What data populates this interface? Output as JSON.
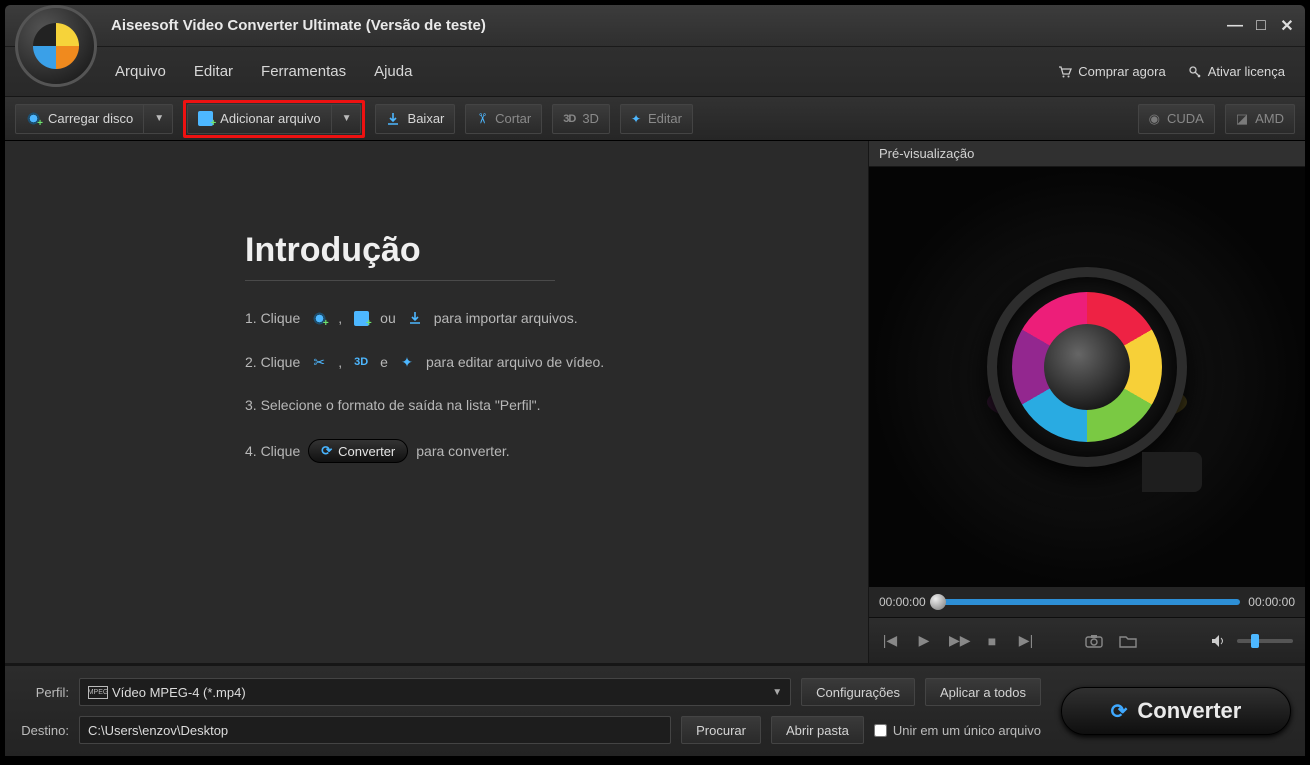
{
  "title": "Aiseesoft Video Converter Ultimate (Versão de teste)",
  "window_controls": {
    "minimize": "—",
    "maximize": "□",
    "close": "✕"
  },
  "menu": {
    "file": "Arquivo",
    "edit": "Editar",
    "tools": "Ferramentas",
    "help": "Ajuda"
  },
  "header_right": {
    "buy": "Comprar agora",
    "activate": "Ativar licença"
  },
  "toolbar": {
    "load_disc": "Carregar disco",
    "add_file": "Adicionar arquivo",
    "download": "Baixar",
    "cut": "Cortar",
    "three_d": "3D",
    "edit": "Editar",
    "cuda": "CUDA",
    "amd": "AMD"
  },
  "intro": {
    "heading": "Introdução",
    "step1_a": "1. Clique",
    "step1_b": ",",
    "step1_c": "ou",
    "step1_d": "para importar arquivos.",
    "step2_a": "2. Clique",
    "step2_b": ",",
    "step2_c": "e",
    "step2_d": "para editar arquivo de vídeo.",
    "step3": "3. Selecione o formato de saída na lista \"Perfil\".",
    "step4_a": "4. Clique",
    "step4_btn": "Converter",
    "step4_b": "para converter."
  },
  "preview": {
    "label": "Pré-visualização",
    "t_start": "00:00:00",
    "t_end": "00:00:00"
  },
  "bottom": {
    "profile_label": "Perfil:",
    "profile_value": "Vídeo MPEG-4 (*.mp4)",
    "settings": "Configurações",
    "apply_all": "Aplicar a todos",
    "dest_label": "Destino:",
    "dest_value": "C:\\Users\\enzov\\Desktop",
    "browse": "Procurar",
    "open_folder": "Abrir pasta",
    "merge": "Unir em um único arquivo",
    "convert": "Converter"
  }
}
